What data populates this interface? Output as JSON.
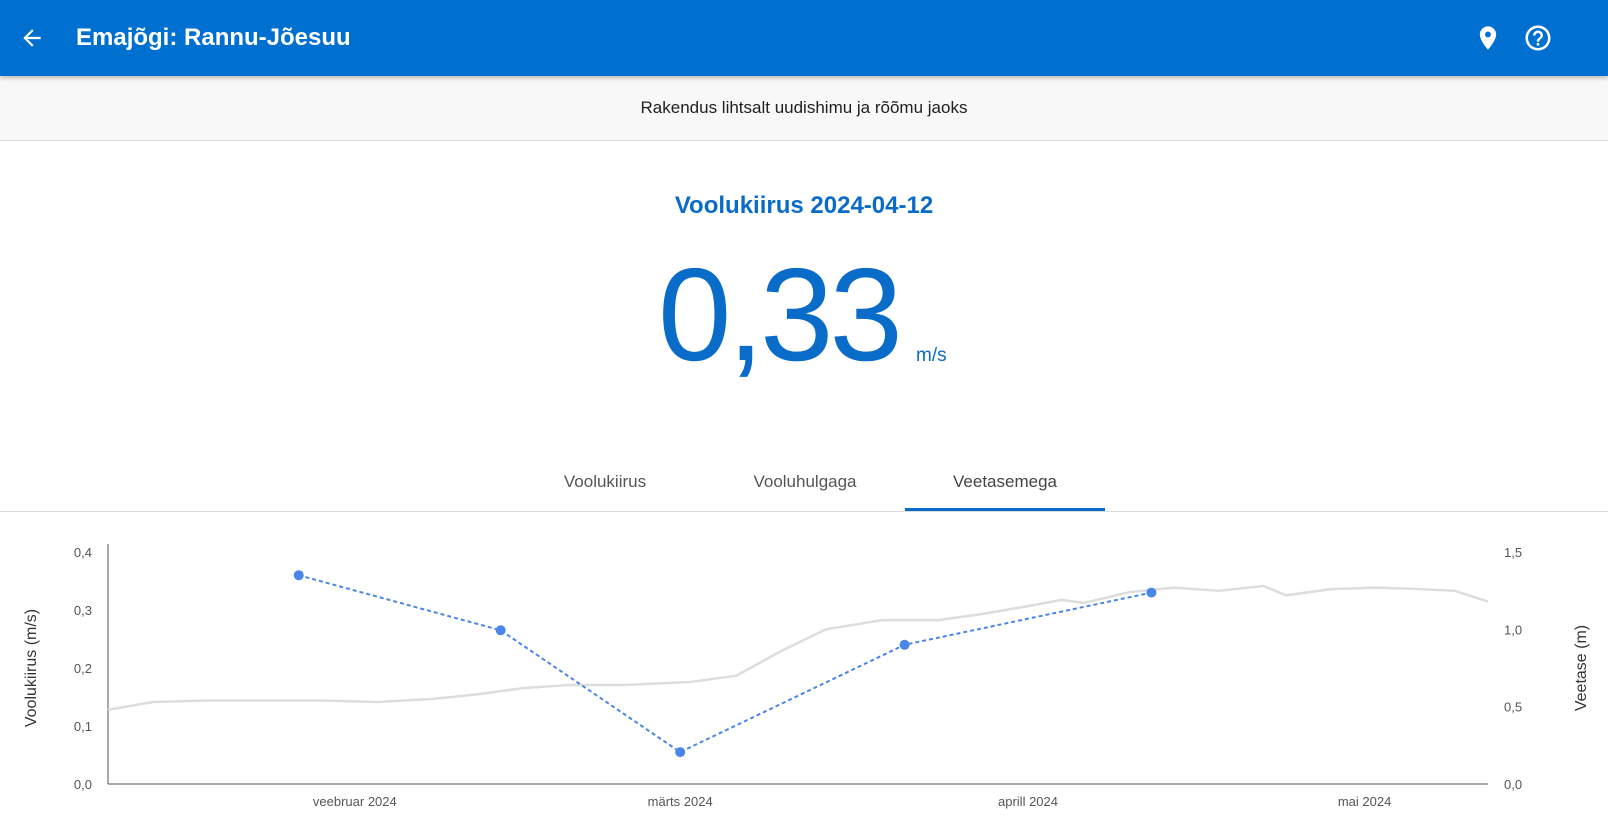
{
  "header": {
    "title": "Emajõgi: Rannu-Jõesuu",
    "back_icon": "arrow-back-icon",
    "location_icon": "location-pin-icon",
    "help_icon": "help-circle-icon",
    "background_color": "#0070d0"
  },
  "banner": {
    "text": "Rakendus lihtsalt uudishimu ja rõõmu jaoks"
  },
  "reading": {
    "title": "Voolukiirus 2024-04-12",
    "value": "0,33",
    "unit": "m/s",
    "color": "#0a6cc9"
  },
  "tabs": [
    {
      "label": "Voolukiirus",
      "active": false
    },
    {
      "label": "Vooluhulgaga",
      "active": false
    },
    {
      "label": "Veetasemega",
      "active": true
    }
  ],
  "chart_data": {
    "type": "line",
    "x_axis": {
      "type": "date",
      "range": [
        "2024-01-10",
        "2024-05-12"
      ],
      "tick_labels": [
        "veebruar 2024",
        "märts 2024",
        "aprill 2024",
        "mai 2024"
      ],
      "tick_dates": [
        "2024-02-01",
        "2024-03-01",
        "2024-04-01",
        "2024-05-01"
      ]
    },
    "y_left": {
      "label": "Voolukiirus (m/s)",
      "range": [
        0,
        0.4
      ],
      "ticks": [
        "0,0",
        "0,1",
        "0,2",
        "0,3",
        "0,4"
      ],
      "tick_values": [
        0,
        0.1,
        0.2,
        0.3,
        0.4
      ]
    },
    "y_right": {
      "label": "Veetase (m)",
      "range": [
        0,
        1.5
      ],
      "ticks": [
        "0,0",
        "0,5",
        "1,0",
        "1,5"
      ],
      "tick_values": [
        0,
        0.5,
        1.0,
        1.5
      ]
    },
    "grid": false,
    "series": [
      {
        "axis": "left",
        "style": "dashed-markers",
        "color": "#4a86e8",
        "points": [
          {
            "date": "2024-01-27",
            "value": 0.36
          },
          {
            "date": "2024-02-14",
            "value": 0.265
          },
          {
            "date": "2024-03-01",
            "value": 0.055
          },
          {
            "date": "2024-03-21",
            "value": 0.24
          },
          {
            "date": "2024-04-12",
            "value": 0.33
          }
        ]
      },
      {
        "axis": "right",
        "style": "solid",
        "color": "#dddddd",
        "points": [
          {
            "date": "2024-01-10",
            "value": 0.48
          },
          {
            "date": "2024-01-14",
            "value": 0.53
          },
          {
            "date": "2024-01-19",
            "value": 0.54
          },
          {
            "date": "2024-01-24",
            "value": 0.54
          },
          {
            "date": "2024-01-29",
            "value": 0.54
          },
          {
            "date": "2024-02-03",
            "value": 0.53
          },
          {
            "date": "2024-02-08",
            "value": 0.55
          },
          {
            "date": "2024-02-12",
            "value": 0.58
          },
          {
            "date": "2024-02-16",
            "value": 0.62
          },
          {
            "date": "2024-02-20",
            "value": 0.64
          },
          {
            "date": "2024-02-25",
            "value": 0.64
          },
          {
            "date": "2024-03-02",
            "value": 0.66
          },
          {
            "date": "2024-03-06",
            "value": 0.7
          },
          {
            "date": "2024-03-10",
            "value": 0.86
          },
          {
            "date": "2024-03-14",
            "value": 1.0
          },
          {
            "date": "2024-03-19",
            "value": 1.06
          },
          {
            "date": "2024-03-24",
            "value": 1.06
          },
          {
            "date": "2024-03-28",
            "value": 1.1
          },
          {
            "date": "2024-04-01",
            "value": 1.15
          },
          {
            "date": "2024-04-04",
            "value": 1.19
          },
          {
            "date": "2024-04-06",
            "value": 1.17
          },
          {
            "date": "2024-04-10",
            "value": 1.24
          },
          {
            "date": "2024-04-14",
            "value": 1.27
          },
          {
            "date": "2024-04-18",
            "value": 1.25
          },
          {
            "date": "2024-04-22",
            "value": 1.28
          },
          {
            "date": "2024-04-24",
            "value": 1.22
          },
          {
            "date": "2024-04-28",
            "value": 1.26
          },
          {
            "date": "2024-05-02",
            "value": 1.27
          },
          {
            "date": "2024-05-06",
            "value": 1.26
          },
          {
            "date": "2024-05-09",
            "value": 1.25
          },
          {
            "date": "2024-05-12",
            "value": 1.18
          }
        ]
      }
    ]
  }
}
